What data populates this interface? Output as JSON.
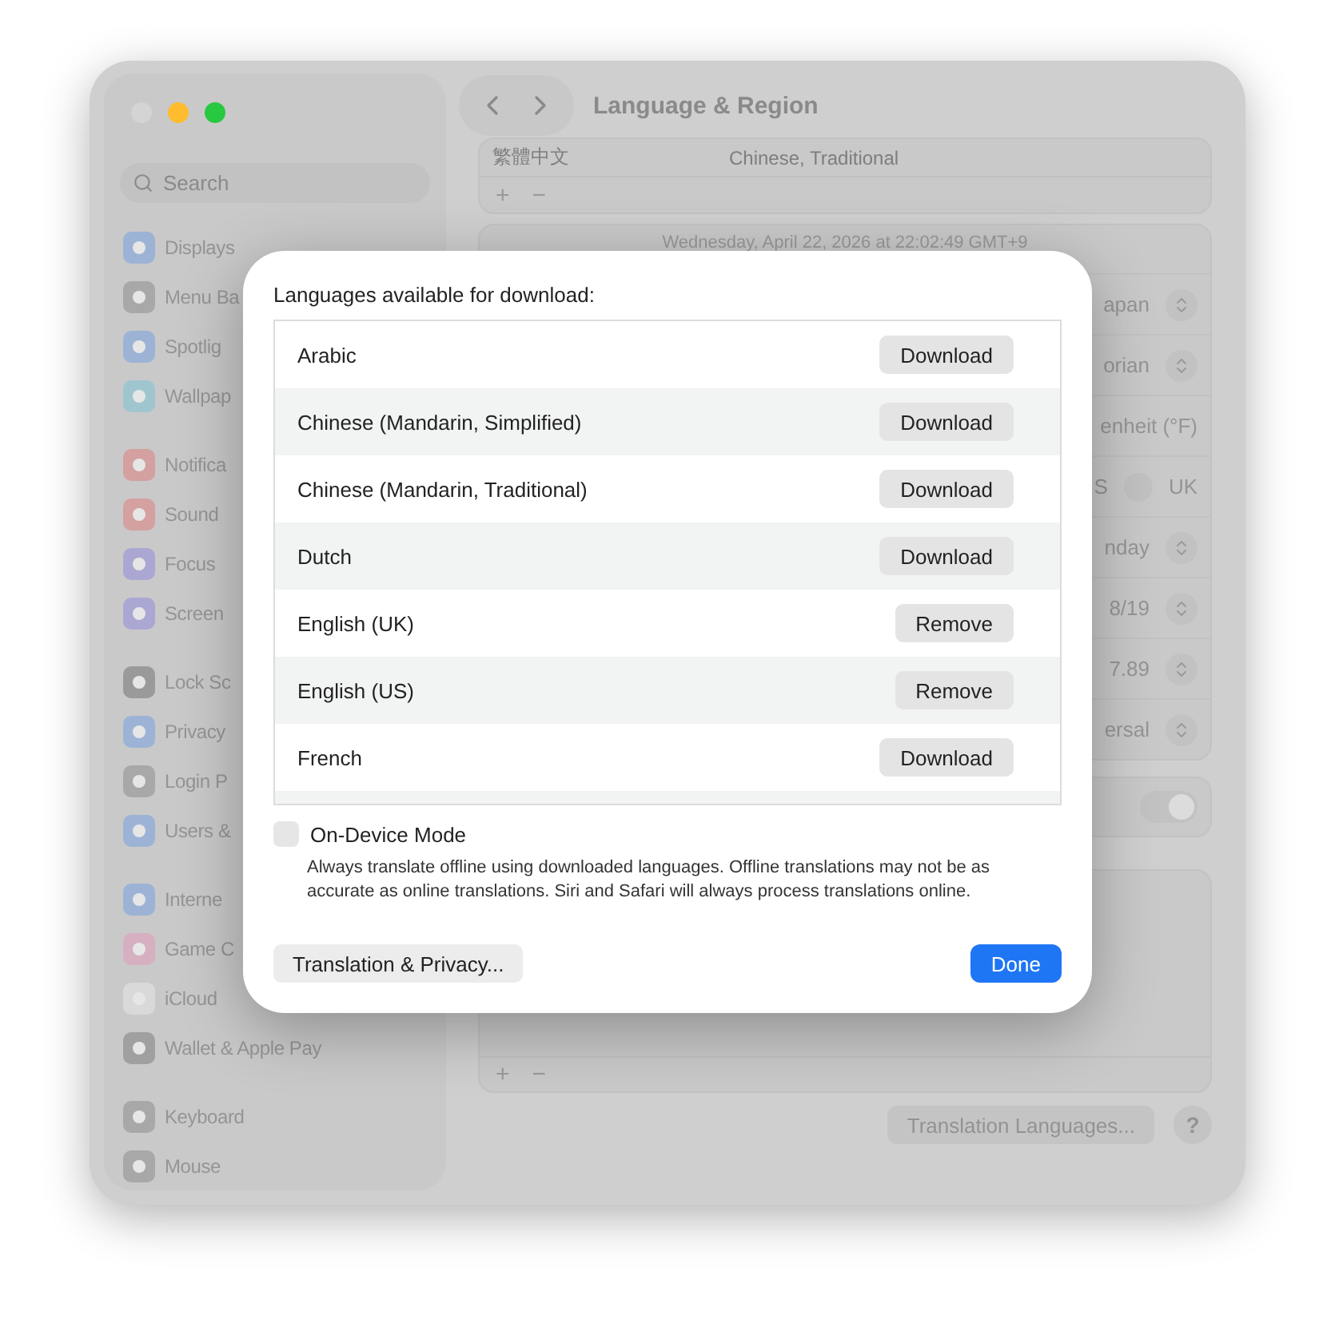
{
  "window": {
    "title": "Language & Region"
  },
  "sidebar": {
    "search": {
      "placeholder": "Search"
    },
    "groups": [
      {
        "items": [
          {
            "label": "Displays",
            "color": "#9db3d6"
          },
          {
            "label": "Menu Ba",
            "color": "#a8a8a8"
          },
          {
            "label": "Spotlig",
            "color": "#9db3d6"
          },
          {
            "label": "Wallpap",
            "color": "#9fc6cf"
          }
        ]
      },
      {
        "items": [
          {
            "label": "Notifica",
            "color": "#d4a0a0"
          },
          {
            "label": "Sound",
            "color": "#d4a0a0"
          },
          {
            "label": "Focus",
            "color": "#aba7d3"
          },
          {
            "label": "Screen",
            "color": "#aba7d3"
          }
        ]
      },
      {
        "items": [
          {
            "label": "Lock Sc",
            "color": "#9a9a9a"
          },
          {
            "label": "Privacy",
            "color": "#9db3d6"
          },
          {
            "label": "Login P",
            "color": "#a8a8a8"
          },
          {
            "label": "Users &",
            "color": "#9db3d6"
          }
        ]
      },
      {
        "items": [
          {
            "label": "Interne",
            "color": "#9db3d6"
          },
          {
            "label": "Game C",
            "color": "#d6b0c0"
          },
          {
            "label": "iCloud",
            "color": "#d9d9d9"
          },
          {
            "label": "Wallet & Apple Pay",
            "color": "#a0a0a0"
          }
        ]
      },
      {
        "items": [
          {
            "label": "Keyboard",
            "color": "#a8a8a8"
          },
          {
            "label": "Mouse",
            "color": "#a8a8a8"
          }
        ]
      }
    ]
  },
  "preferred_languages": {
    "rows": [
      {
        "name": "繁體中文",
        "detail": "Chinese, Traditional"
      }
    ],
    "add": "+",
    "remove": "−"
  },
  "region": {
    "date": "Wednesday, April 22, 2026 at 22:02:49 GMT+9",
    "rows": [
      {
        "kind": "popup",
        "value": "apan"
      },
      {
        "kind": "popup",
        "value": "orian"
      },
      {
        "kind": "text",
        "value": "enheit (°F)"
      },
      {
        "kind": "radio",
        "value": "S",
        "option": "UK",
        "option_selected": false
      },
      {
        "kind": "popup",
        "value": "nday"
      },
      {
        "kind": "popup",
        "value": "8/19"
      },
      {
        "kind": "popup",
        "value": "7.89"
      },
      {
        "kind": "popup",
        "value": "ersal"
      }
    ]
  },
  "toggle": {
    "on": true
  },
  "apps_list": {
    "add": "+",
    "remove": "−"
  },
  "footer": {
    "button": "Translation Languages...",
    "help": "?"
  },
  "translation_dialog": {
    "title": "Languages available for download:",
    "languages": [
      {
        "name": "Arabic",
        "action": "Download"
      },
      {
        "name": "Chinese (Mandarin, Simplified)",
        "action": "Download"
      },
      {
        "name": "Chinese (Mandarin, Traditional)",
        "action": "Download"
      },
      {
        "name": "Dutch",
        "action": "Download"
      },
      {
        "name": "English (UK)",
        "action": "Remove"
      },
      {
        "name": "English (US)",
        "action": "Remove"
      },
      {
        "name": "French",
        "action": "Download"
      }
    ],
    "on_device_mode": {
      "label": "On-Device Mode",
      "checked": false,
      "description": "Always translate offline using downloaded languages. Offline translations may not be as accurate as online translations. Siri and Safari will always process translations online."
    },
    "privacy_button": "Translation & Privacy...",
    "done_button": "Done"
  }
}
